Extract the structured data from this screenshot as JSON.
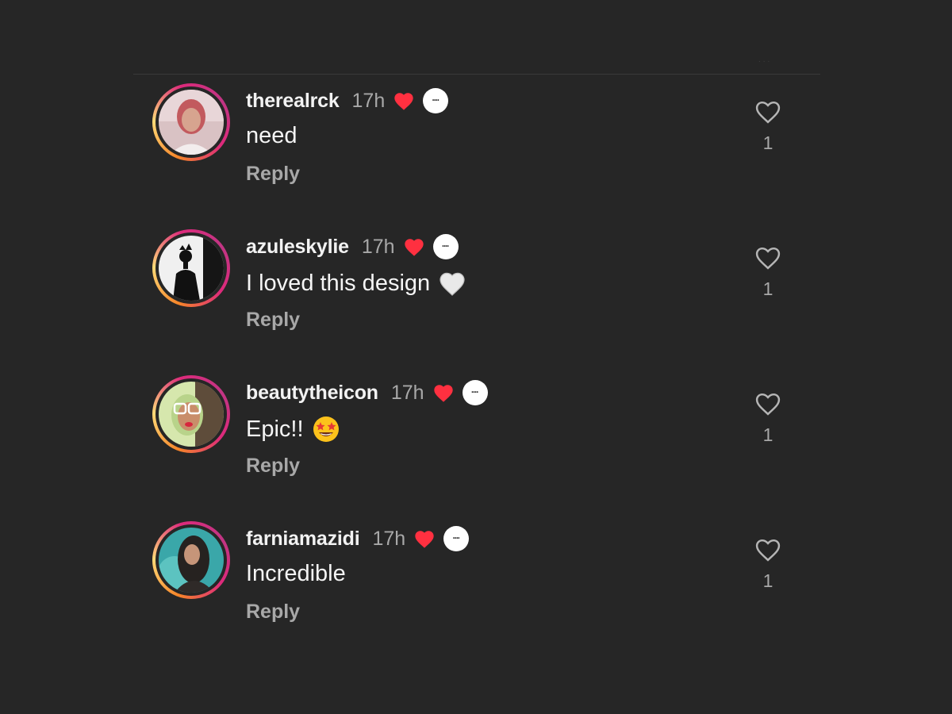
{
  "comments": [
    {
      "username": "therealrck",
      "time": "17h",
      "text": "need",
      "reply": "Reply",
      "likes": "1",
      "emoji": "",
      "avatar_colors": [
        "#c9a3a8",
        "#e8d2d4"
      ]
    },
    {
      "username": "azuleskylie",
      "time": "17h",
      "text": "I loved this design",
      "reply": "Reply",
      "likes": "1",
      "emoji": "white-heart-emoji",
      "avatar_colors": [
        "#f2f2f2",
        "#111111"
      ]
    },
    {
      "username": "beautytheicon",
      "time": "17h",
      "text": "Epic!!",
      "reply": "Reply",
      "likes": "1",
      "emoji": "star-struck-emoji",
      "avatar_colors": [
        "#d7e9b0",
        "#5b4a3a"
      ]
    },
    {
      "username": "farniamazidi",
      "time": "17h",
      "text": "Incredible",
      "reply": "Reply",
      "likes": "1",
      "emoji": "",
      "avatar_colors": [
        "#3fa6a8",
        "#2a2a2a"
      ]
    }
  ],
  "colors": {
    "background": "#262626",
    "liked_heart": "#ff3040",
    "secondary_text": "#a8a8a8"
  }
}
